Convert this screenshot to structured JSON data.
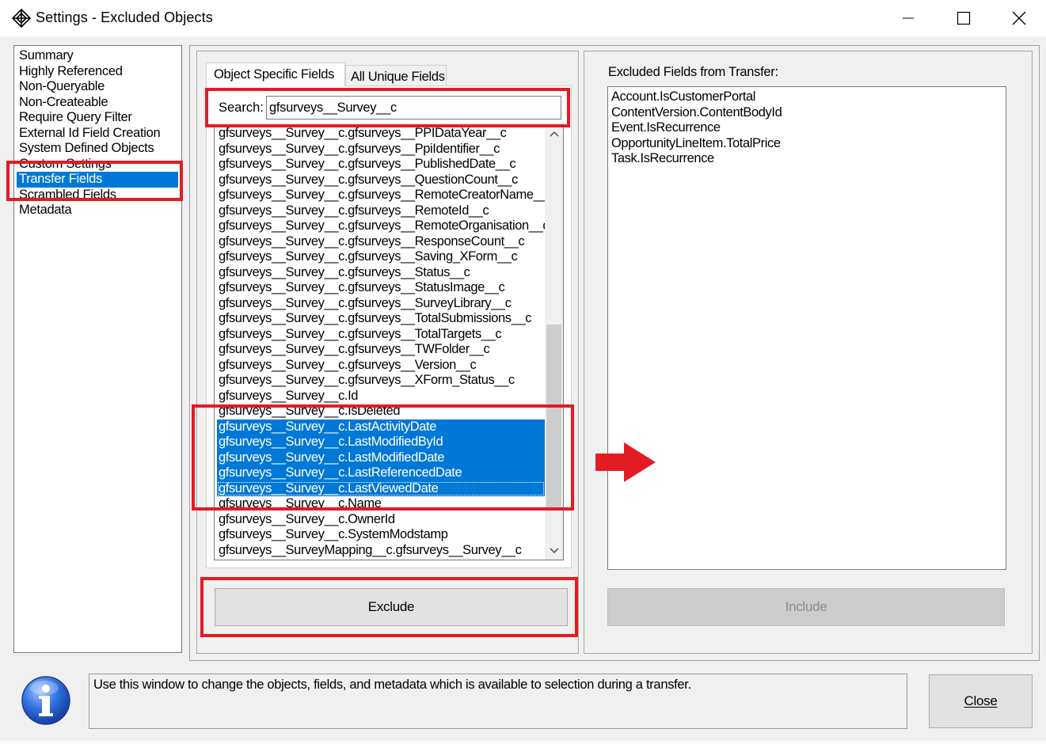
{
  "window": {
    "title": "Settings - Excluded Objects",
    "controls": [
      "minimize",
      "maximize",
      "close"
    ]
  },
  "nav": {
    "items": [
      "Summary",
      "Highly Referenced",
      "Non-Queryable",
      "Non-Createable",
      "Require Query Filter",
      "External Id Field Creation",
      "System Defined Objects",
      "Custom Settings",
      "Transfer Fields",
      "Scrambled Fields",
      "Metadata"
    ],
    "selected": "Transfer Fields"
  },
  "tabs": {
    "active": "Object Specific Fields",
    "inactive": "All Unique Fields"
  },
  "search": {
    "label": "Search:",
    "value": "gfsurveys__Survey__c"
  },
  "fields": {
    "items": [
      "gfsurveys__Survey__c.gfsurveys__PPIDataYear__c",
      "gfsurveys__Survey__c.gfsurveys__PpiIdentifier__c",
      "gfsurveys__Survey__c.gfsurveys__PublishedDate__c",
      "gfsurveys__Survey__c.gfsurveys__QuestionCount__c",
      "gfsurveys__Survey__c.gfsurveys__RemoteCreatorName__c",
      "gfsurveys__Survey__c.gfsurveys__RemoteId__c",
      "gfsurveys__Survey__c.gfsurveys__RemoteOrganisation__c",
      "gfsurveys__Survey__c.gfsurveys__ResponseCount__c",
      "gfsurveys__Survey__c.gfsurveys__Saving_XForm__c",
      "gfsurveys__Survey__c.gfsurveys__Status__c",
      "gfsurveys__Survey__c.gfsurveys__StatusImage__c",
      "gfsurveys__Survey__c.gfsurveys__SurveyLibrary__c",
      "gfsurveys__Survey__c.gfsurveys__TotalSubmissions__c",
      "gfsurveys__Survey__c.gfsurveys__TotalTargets__c",
      "gfsurveys__Survey__c.gfsurveys__TWFolder__c",
      "gfsurveys__Survey__c.gfsurveys__Version__c",
      "gfsurveys__Survey__c.gfsurveys__XForm_Status__c",
      "gfsurveys__Survey__c.Id",
      "gfsurveys__Survey__c.IsDeleted",
      "gfsurveys__Survey__c.LastActivityDate",
      "gfsurveys__Survey__c.LastModifiedById",
      "gfsurveys__Survey__c.LastModifiedDate",
      "gfsurveys__Survey__c.LastReferencedDate",
      "gfsurveys__Survey__c.LastViewedDate",
      "gfsurveys__Survey__c.Name",
      "gfsurveys__Survey__c.OwnerId",
      "gfsurveys__Survey__c.SystemModstamp",
      "gfsurveys__SurveyMapping__c.gfsurveys__Survey__c"
    ],
    "selected": [
      "gfsurveys__Survey__c.LastActivityDate",
      "gfsurveys__Survey__c.LastModifiedById",
      "gfsurveys__Survey__c.LastModifiedDate",
      "gfsurveys__Survey__c.LastReferencedDate",
      "gfsurveys__Survey__c.LastViewedDate"
    ]
  },
  "buttons": {
    "exclude": "Exclude",
    "include": "Include",
    "close": "Close"
  },
  "excluded": {
    "label": "Excluded Fields from Transfer:",
    "items": [
      "Account.IsCustomerPortal",
      "ContentVersion.ContentBodyId",
      "Event.IsRecurrence",
      "OpportunityLineItem.TotalPrice",
      "Task.IsRecurrence"
    ]
  },
  "info": {
    "text": "Use this window to change the objects, fields, and metadata which is available to selection during a transfer.",
    "icon": "info-icon"
  },
  "colors": {
    "selection": "#0078d7",
    "annotation": "#e31b23",
    "window_bg": "#f0f0f0"
  }
}
